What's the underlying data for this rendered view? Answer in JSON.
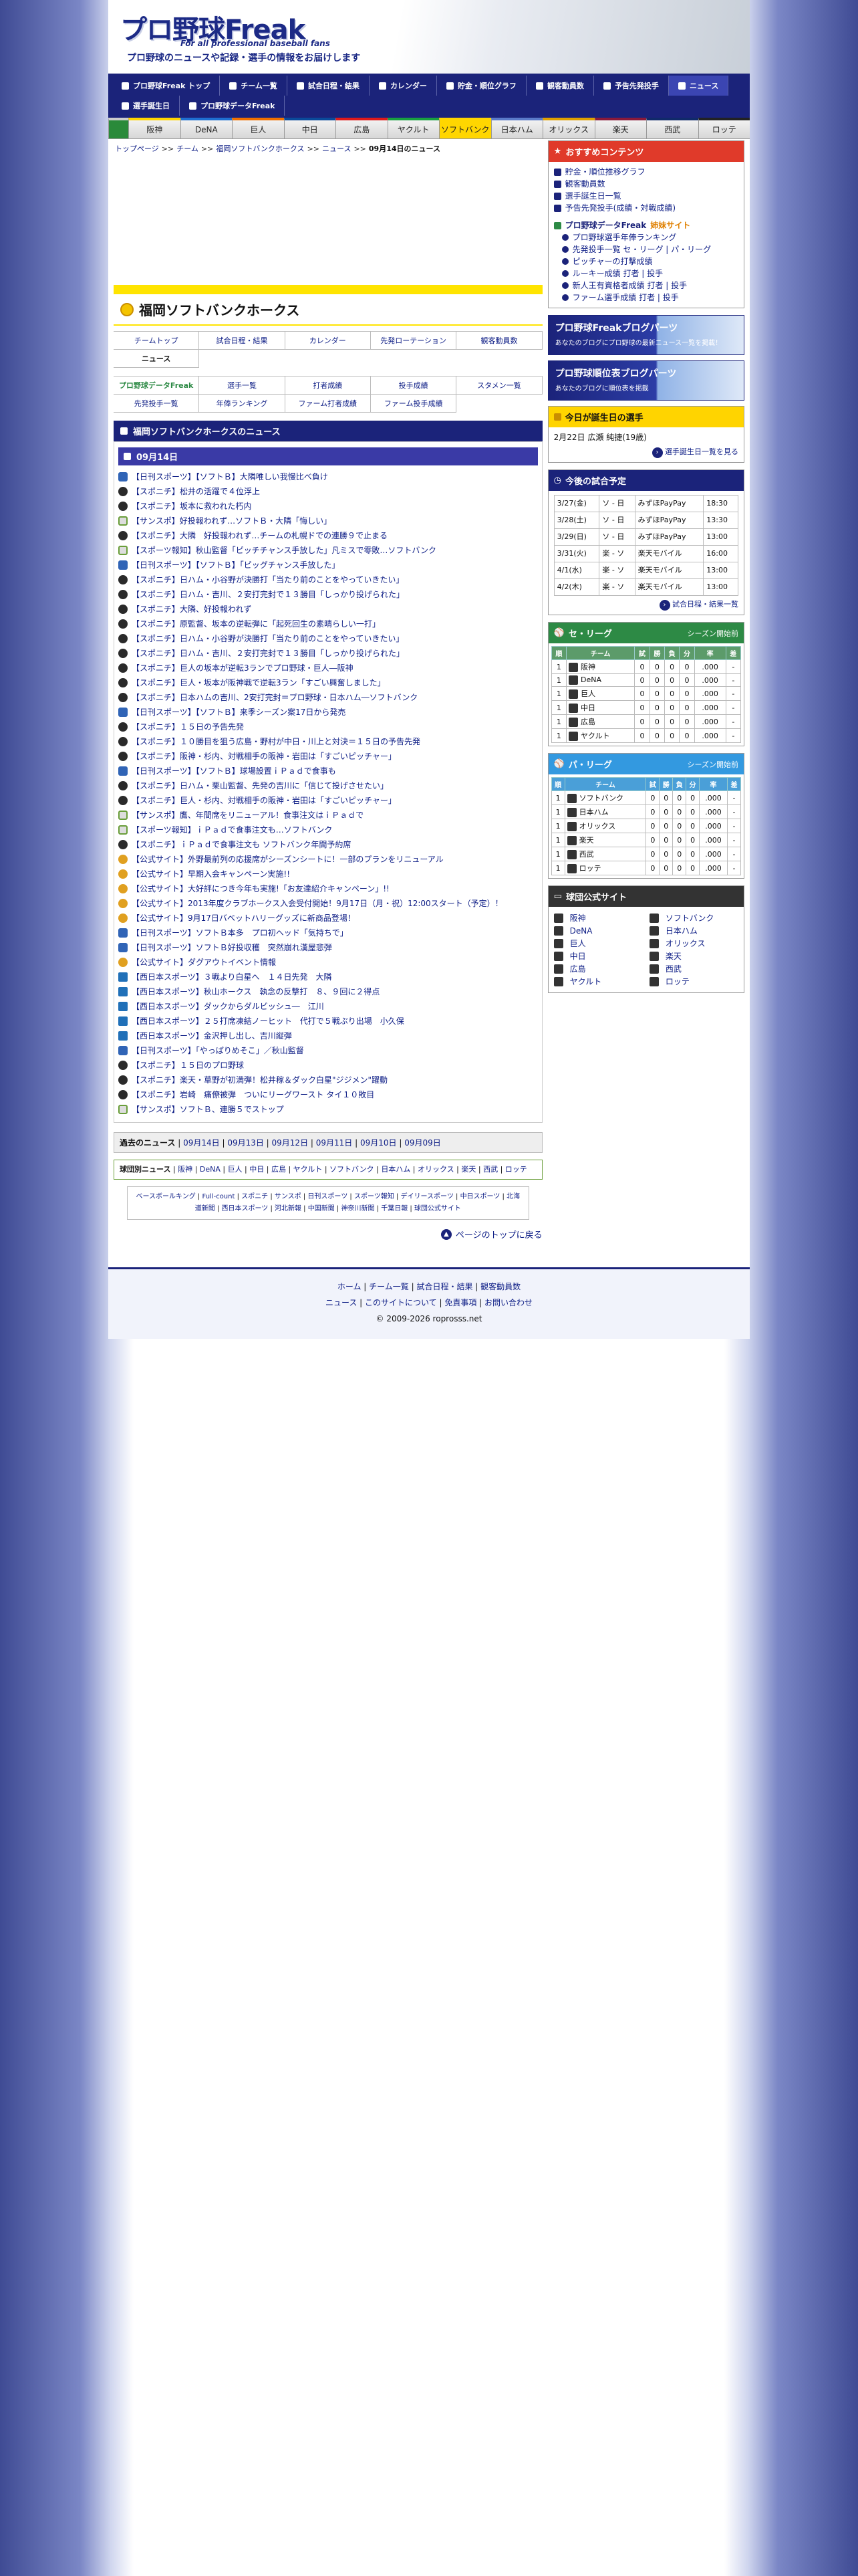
{
  "header": {
    "logo": "プロ野球Freak",
    "logo_sub": "For all professional baseball fans",
    "tagline": "プロ野球のニュースや記録・選手の情報をお届けします"
  },
  "gnav": [
    {
      "label": "プロ野球Freak トップ"
    },
    {
      "label": "チーム一覧"
    },
    {
      "label": "試合日程・結果"
    },
    {
      "label": "カレンダー"
    },
    {
      "label": "貯金・順位グラフ"
    },
    {
      "label": "観客動員数"
    },
    {
      "label": "予告先発投手"
    },
    {
      "label": "ニュース"
    },
    {
      "label": "選手誕生日"
    },
    {
      "label": "プロ野球データFreak"
    }
  ],
  "teams": [
    "阪神",
    "DeNA",
    "巨人",
    "中日",
    "広島",
    "ヤクルト",
    "ソフトバンク",
    "日本ハム",
    "オリックス",
    "楽天",
    "西武",
    "ロッテ"
  ],
  "team_colors": [
    "#ffd400",
    "#1e6fd0",
    "#f07000",
    "#0a4a9a",
    "#e01a1a",
    "#18a040",
    "#ffd600",
    "#5a7ac8",
    "#e0a000",
    "#8b1a3a",
    "#102a6a",
    "#222222"
  ],
  "breadcrumb": {
    "items": [
      "トップページ",
      "チーム",
      "福岡ソフトバンクホークス",
      "ニュース"
    ],
    "sep": ">>",
    "current": "09月14日のニュース"
  },
  "team_title": "福岡ソフトバンクホークス",
  "subnav1": [
    "チームトップ",
    "試合日程・結果",
    "カレンダー",
    "先発ローテーション",
    "観客動員数",
    "ニュース"
  ],
  "subnav2": [
    "プロ野球データFreak",
    "選手一覧",
    "打者成績",
    "投手成績",
    "スタメン一覧",
    "先発投手一覧",
    "年俸ランキング",
    "ファーム打者成績",
    "ファーム投手成績"
  ],
  "news_title": "福岡ソフトバンクホークスのニュース",
  "news_date": "09月14日",
  "news": [
    {
      "t": "【日刊スポーツ】【ソフトＢ】大隣唯しい我慢比べ負け",
      "i": "b"
    },
    {
      "t": "【スポニチ】松井の活躍で４位浮上",
      "i": "a"
    },
    {
      "t": "【スポニチ】坂本に救われた朽内",
      "i": "a"
    },
    {
      "t": "【サンスポ】好投報われず…ソフトＢ・大隣「悔しい」",
      "i": "c"
    },
    {
      "t": "【スポニチ】大隣　好投報われず…チームの札幌ドでの連勝９で止まる",
      "i": "a"
    },
    {
      "t": "【スポーツ報知】秋山監督「ピッチチャンス手放した」凡ミスで零敗…ソフトバンク",
      "i": "c"
    },
    {
      "t": "【日刊スポーツ】【ソフトＢ】「ピッグチャンス手放した」",
      "i": "b"
    },
    {
      "t": "【スポニチ】日ハム・小谷野が決勝打「当たり前のことをやっていきたい」",
      "i": "a"
    },
    {
      "t": "【スポニチ】日ハム・吉川、２安打完封で１３勝目「しっかり投げられた」",
      "i": "a"
    },
    {
      "t": "【スポニチ】大隣、好投報われず",
      "i": "a"
    },
    {
      "t": "【スポニチ】原監督、坂本の逆転弾に「起死回生の素晴らしい一打」",
      "i": "a"
    },
    {
      "t": "【スポニチ】日ハム・小谷野が決勝打「当たり前のことをやっていきたい」",
      "i": "a"
    },
    {
      "t": "【スポニチ】日ハム・吉川、２安打完封で１３勝目「しっかり投げられた」",
      "i": "a"
    },
    {
      "t": "【スポニチ】巨人の坂本が逆転3ランでプロ野球・巨人―阪神",
      "i": "a"
    },
    {
      "t": "【スポニチ】巨人・坂本が阪神戦で逆転3ラン「すごい興奮しました」",
      "i": "a"
    },
    {
      "t": "【スポニチ】日本ハムの吉川、2安打完封＝プロ野球・日本ハム―ソフトバンク",
      "i": "a"
    },
    {
      "t": "【日刊スポーツ】【ソフトＢ】来季シーズン案17日から発売",
      "i": "b"
    },
    {
      "t": "【スポニチ】１５日の予告先発",
      "i": "a"
    },
    {
      "t": "【スポニチ】１０勝目を狙う広島・野村が中日・川上と対決＝１５日の予告先発",
      "i": "a"
    },
    {
      "t": "【スポニチ】阪神・杉内、対戦相手の阪神・岩田は「すごいピッチャー」",
      "i": "a"
    },
    {
      "t": "【日刊スポーツ】【ソフトＢ】球場設置ｉＰａｄで食事も",
      "i": "b"
    },
    {
      "t": "【スポニチ】日ハム・栗山監督、先発の吉川に「信じて投げさせたい」",
      "i": "a"
    },
    {
      "t": "【スポニチ】巨人・杉内、対戦相手の阪神・岩田は「すごいピッチャー」",
      "i": "a"
    },
    {
      "t": "【サンスポ】鷹、年間席をリニューアル！食事注文はｉＰａｄで",
      "i": "c"
    },
    {
      "t": "【スポーツ報知】ｉＰａｄで食事注文も…ソフトバンク",
      "i": "c"
    },
    {
      "t": "【スポニチ】ｉＰａｄで食事注文も ソフトバンク年間予約席",
      "i": "a"
    },
    {
      "t": "【公式サイト】外野最前列の応援席がシーズンシートに！一部のプランをリニューアル",
      "i": "d"
    },
    {
      "t": "【公式サイト】早期入会キャンペーン実施!!",
      "i": "d"
    },
    {
      "t": "【公式サイト】大好評につき今年も実施!「お友達紹介キャンペーン」!!",
      "i": "d"
    },
    {
      "t": "【公式サイト】2013年度クラブホークス入会受付開始！9月17日（月・祝）12:00スタート（予定）！",
      "i": "d"
    },
    {
      "t": "【公式サイト】9月17日バベットハリーグッズに新商品登場！",
      "i": "d"
    },
    {
      "t": "【日刊スポーツ】ソフトＢ本多　プロ初ヘッド「気持ちで」",
      "i": "b"
    },
    {
      "t": "【日刊スポーツ】ソフトＢ好投収穫　突然崩れ漢屋悲弾",
      "i": "b"
    },
    {
      "t": "【公式サイト】ダグアウトイベント情報",
      "i": "d"
    },
    {
      "t": "【西日本スポーツ】３戦より白星へ　１４日先発　大隣",
      "i": "e"
    },
    {
      "t": "【西日本スポーツ】秋山ホークス　執念の反撃打　８、９回に２得点",
      "i": "e"
    },
    {
      "t": "【西日本スポーツ】ダックからダルビッシュ―　江川",
      "i": "e"
    },
    {
      "t": "【西日本スポーツ】２５打席凍結ノーヒット　代打で５戦ぶり出場　小久保",
      "i": "e"
    },
    {
      "t": "【西日本スポーツ】金沢押し出し、吉川縦弾",
      "i": "e"
    },
    {
      "t": "【日刊スポーツ】「やっぱりめそこ」／秋山監督",
      "i": "b"
    },
    {
      "t": "【スポニチ】１５日のプロ野球",
      "i": "a"
    },
    {
      "t": "【スポニチ】楽天・草野が初満弾！松井稼＆ダック白星\"ジジメン\"躍動",
      "i": "a"
    },
    {
      "t": "【スポニチ】岩崎　痛僚被弾　ついにリーグワースト タイ１０敗目",
      "i": "a"
    },
    {
      "t": "【サンスポ】ソフトＢ、連勝５でストップ",
      "i": "c"
    }
  ],
  "past_news": {
    "label": "過去のニュース",
    "dates": [
      "09月14日",
      "09月13日",
      "09月12日",
      "09月11日",
      "09月10日",
      "09月09日"
    ]
  },
  "team_links": {
    "label": "球団別ニュース",
    "items": [
      "阪神",
      "DeNA",
      "巨人",
      "中日",
      "広島",
      "ヤクルト",
      "ソフトバンク",
      "日本ハム",
      "オリックス",
      "楽天",
      "西武",
      "ロッテ"
    ]
  },
  "media_links": [
    "ベースボールキング",
    "Full-count",
    "スポニチ",
    "サンスポ",
    "日刊スポーツ",
    "スポーツ報知",
    "デイリースポーツ",
    "中日スポーツ",
    "北海道新聞",
    "西日本スポーツ",
    "河北新報",
    "中国新聞",
    "神奈川新聞",
    "千葉日報",
    "球団公式サイト"
  ],
  "back_to_top": "ページのトップに戻る",
  "side": {
    "recommend_title": "おすすめコンテンツ",
    "recommend": [
      "貯金・順位推移グラフ",
      "観客動員数",
      "選手誕生日一覧",
      "予告先発投手(成績・対戦成績)"
    ],
    "data_title": "プロ野球データFreak",
    "data_suffix": "姉妹サイト",
    "data_items": [
      "プロ野球選手年俸ランキング",
      "先発投手一覧 セ・リーグ | パ・リーグ",
      "ピッチャーの打撃成績",
      "ルーキー成績 打者 | 投手",
      "新人王有資格者成績 打者 | 投手",
      "ファーム選手成績 打者 | 投手"
    ],
    "banner1": {
      "title": "プロ野球Freakブログパーツ",
      "sub": "あなたのブログにプロ野球の最新ニュース一覧を掲載！"
    },
    "banner2": {
      "title": "プロ野球順位表ブログパーツ",
      "sub": "あなたのブログに順位表を掲載"
    },
    "birthday_title": "今日が誕生日の選手",
    "birthday_text": "2月22日 広瀬 純捷(19歳)",
    "birthday_more": "選手誕生日一覧を見る",
    "schedule_title": "今後の試合予定",
    "schedule": [
      {
        "date": "3/27(金)",
        "match": "ソ - 日",
        "venue": "みずほPayPay",
        "time": "18:30"
      },
      {
        "date": "3/28(土)",
        "match": "ソ - 日",
        "venue": "みずほPayPay",
        "time": "13:30"
      },
      {
        "date": "3/29(日)",
        "match": "ソ - 日",
        "venue": "みずほPayPay",
        "time": "13:00"
      },
      {
        "date": "3/31(火)",
        "match": "楽 - ソ",
        "venue": "楽天モバイル",
        "time": "16:00"
      },
      {
        "date": "4/1(水)",
        "match": "楽 - ソ",
        "venue": "楽天モバイル",
        "time": "13:00"
      },
      {
        "date": "4/2(木)",
        "match": "楽 - ソ",
        "venue": "楽天モバイル",
        "time": "13:00"
      }
    ],
    "schedule_more": "試合日程・結果一覧",
    "ce": {
      "title": "セ・リーグ",
      "note": "シーズン開始前",
      "headers": [
        "順",
        "チーム",
        "試",
        "勝",
        "負",
        "分",
        "率",
        "差"
      ],
      "rows": [
        [
          "1",
          "阪神",
          "0",
          "0",
          "0",
          "0",
          ".000",
          "-"
        ],
        [
          "1",
          "DeNA",
          "0",
          "0",
          "0",
          "0",
          ".000",
          "-"
        ],
        [
          "1",
          "巨人",
          "0",
          "0",
          "0",
          "0",
          ".000",
          "-"
        ],
        [
          "1",
          "中日",
          "0",
          "0",
          "0",
          "0",
          ".000",
          "-"
        ],
        [
          "1",
          "広島",
          "0",
          "0",
          "0",
          "0",
          ".000",
          "-"
        ],
        [
          "1",
          "ヤクルト",
          "0",
          "0",
          "0",
          "0",
          ".000",
          "-"
        ]
      ]
    },
    "pa": {
      "title": "パ・リーグ",
      "note": "シーズン開始前",
      "headers": [
        "順",
        "チーム",
        "試",
        "勝",
        "負",
        "分",
        "率",
        "差"
      ],
      "rows": [
        [
          "1",
          "ソフトバンク",
          "0",
          "0",
          "0",
          "0",
          ".000",
          "-"
        ],
        [
          "1",
          "日本ハム",
          "0",
          "0",
          "0",
          "0",
          ".000",
          "-"
        ],
        [
          "1",
          "オリックス",
          "0",
          "0",
          "0",
          "0",
          ".000",
          "-"
        ],
        [
          "1",
          "楽天",
          "0",
          "0",
          "0",
          "0",
          ".000",
          "-"
        ],
        [
          "1",
          "西武",
          "0",
          "0",
          "0",
          "0",
          ".000",
          "-"
        ],
        [
          "1",
          "ロッテ",
          "0",
          "0",
          "0",
          "0",
          ".000",
          "-"
        ]
      ]
    },
    "official_title": "球団公式サイト",
    "official": [
      "阪神",
      "ソフトバンク",
      "DeNA",
      "日本ハム",
      "巨人",
      "オリックス",
      "中日",
      "楽天",
      "広島",
      "西武",
      "ヤクルト",
      "ロッテ"
    ]
  },
  "footer": {
    "links1": [
      "ホーム",
      "チーム一覧",
      "試合日程・結果",
      "観客動員数"
    ],
    "links2": [
      "ニュース",
      "このサイトについて",
      "免責事項",
      "お問い合わせ"
    ],
    "copy": "© 2009-2026 roprosss.net"
  }
}
